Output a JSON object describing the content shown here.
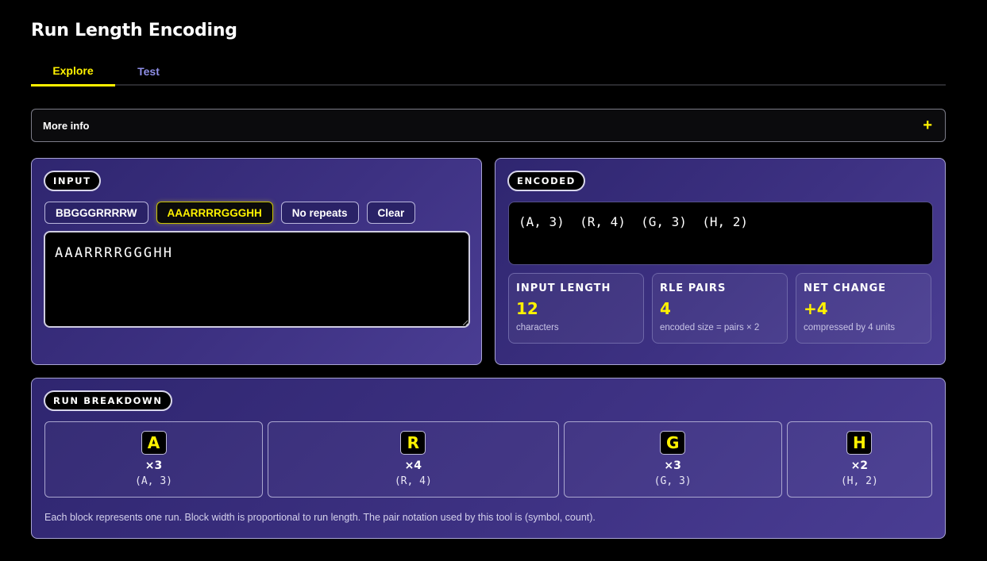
{
  "app": {
    "title": "Run Length Encoding"
  },
  "tabs": [
    {
      "label": "Explore",
      "active": true
    },
    {
      "label": "Test",
      "active": false
    }
  ],
  "more_info": {
    "label": "More info",
    "toggle": "+"
  },
  "input_panel": {
    "badge": "INPUT",
    "presets": [
      {
        "label": "BBGGGRRRRW",
        "active": false
      },
      {
        "label": "AAARRRRGGGHH",
        "active": true
      },
      {
        "label": "No repeats",
        "active": false
      },
      {
        "label": "Clear",
        "active": false
      }
    ],
    "value": "AAARRRRGGGHH"
  },
  "encoded_panel": {
    "badge": "ENCODED",
    "output": "(A, 3)  (R, 4)  (G, 3)  (H, 2)",
    "stats": [
      {
        "label": "INPUT LENGTH",
        "value": "12",
        "sub": "characters"
      },
      {
        "label": "RLE PAIRS",
        "value": "4",
        "sub": "encoded size = pairs × 2"
      },
      {
        "label": "NET CHANGE",
        "value": "+4",
        "sub": "compressed by 4 units"
      }
    ]
  },
  "runs_panel": {
    "badge": "RUN BREAKDOWN",
    "runs": [
      {
        "symbol": "A",
        "count_label": "×3",
        "pair": "(A, 3)",
        "length": 3
      },
      {
        "symbol": "R",
        "count_label": "×4",
        "pair": "(R, 4)",
        "length": 4
      },
      {
        "symbol": "G",
        "count_label": "×3",
        "pair": "(G, 3)",
        "length": 3
      },
      {
        "symbol": "H",
        "count_label": "×2",
        "pair": "(H, 2)",
        "length": 2
      }
    ],
    "note": "Each block represents one run. Block width is proportional to run length. The pair notation used by this tool is (symbol, count)."
  },
  "colors": {
    "accent": "#fff200",
    "panel": "#3a2f7d",
    "tab_inactive": "#8e8ee6"
  }
}
